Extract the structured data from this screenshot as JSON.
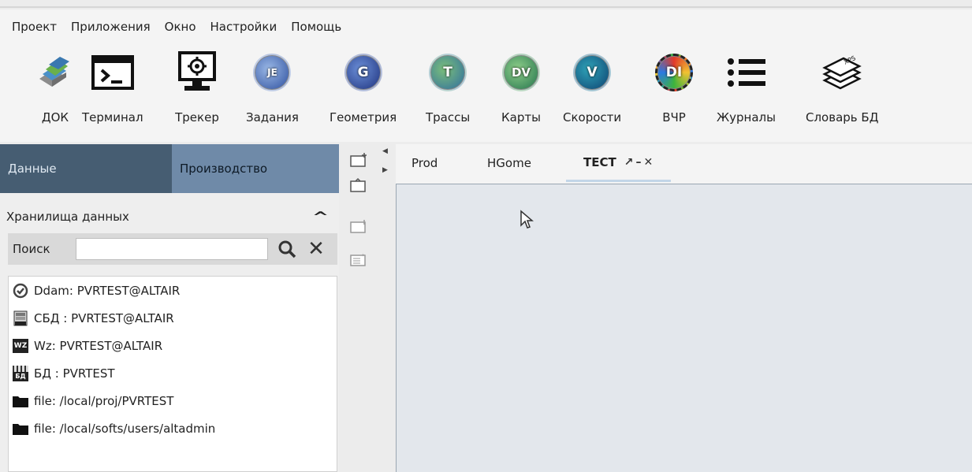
{
  "menu": [
    "Проект",
    "Приложения",
    "Окно",
    "Настройки",
    "Помощь"
  ],
  "toolbar": {
    "items": [
      {
        "label": "ДОК",
        "icon": "books-icon"
      },
      {
        "label": "Терминал",
        "icon": "terminal-icon"
      },
      {
        "label": "Трекер",
        "icon": "monitor-gear-icon"
      },
      {
        "label": "Задания",
        "icon": "jobs-icon",
        "badge": "JE"
      },
      {
        "label": "Геометрия",
        "icon": "geometry-icon",
        "badge": "G"
      },
      {
        "label": "Трассы",
        "icon": "traces-icon",
        "badge": "T"
      },
      {
        "label": "Карты",
        "icon": "maps-icon",
        "badge": "DV"
      },
      {
        "label": "Скорости",
        "icon": "velocities-icon",
        "badge": "V"
      },
      {
        "label": "ВЧР",
        "icon": "vchr-icon",
        "badge": "DI"
      },
      {
        "label": "Журналы",
        "icon": "list-icon"
      },
      {
        "label": "Словарь БД",
        "icon": "dictionary-icon",
        "badge": "XPS"
      }
    ]
  },
  "left_panel": {
    "tabs": [
      "Данные",
      "Производство"
    ],
    "section_title": "Хранилища данных",
    "search_label": "Поиск",
    "search_value": "",
    "items": [
      {
        "label": "Ddam: PVRTEST@ALTAIR",
        "icon": "ddam-icon"
      },
      {
        "label": "СБД : PVRTEST@ALTAIR",
        "icon": "sbd-icon"
      },
      {
        "label": "Wz: PVRTEST@ALTAIR",
        "icon": "wz-icon",
        "badge": "WZ"
      },
      {
        "label": "БД : PVRTEST",
        "icon": "db-icon",
        "badge": "БД"
      },
      {
        "label": "file: /local/proj/PVRTEST",
        "icon": "folder-icon"
      },
      {
        "label": "file: /local/softs/users/altadmin",
        "icon": "folder-icon"
      }
    ]
  },
  "tabs": [
    {
      "label": "Prod",
      "active": false
    },
    {
      "label": "HGome",
      "active": false
    },
    {
      "label": "TECT",
      "active": true
    }
  ],
  "colors": {
    "tab_data_bg": "#465d72",
    "tab_prod_bg": "#6f8aa8",
    "content_bg": "#e3e7ec"
  }
}
